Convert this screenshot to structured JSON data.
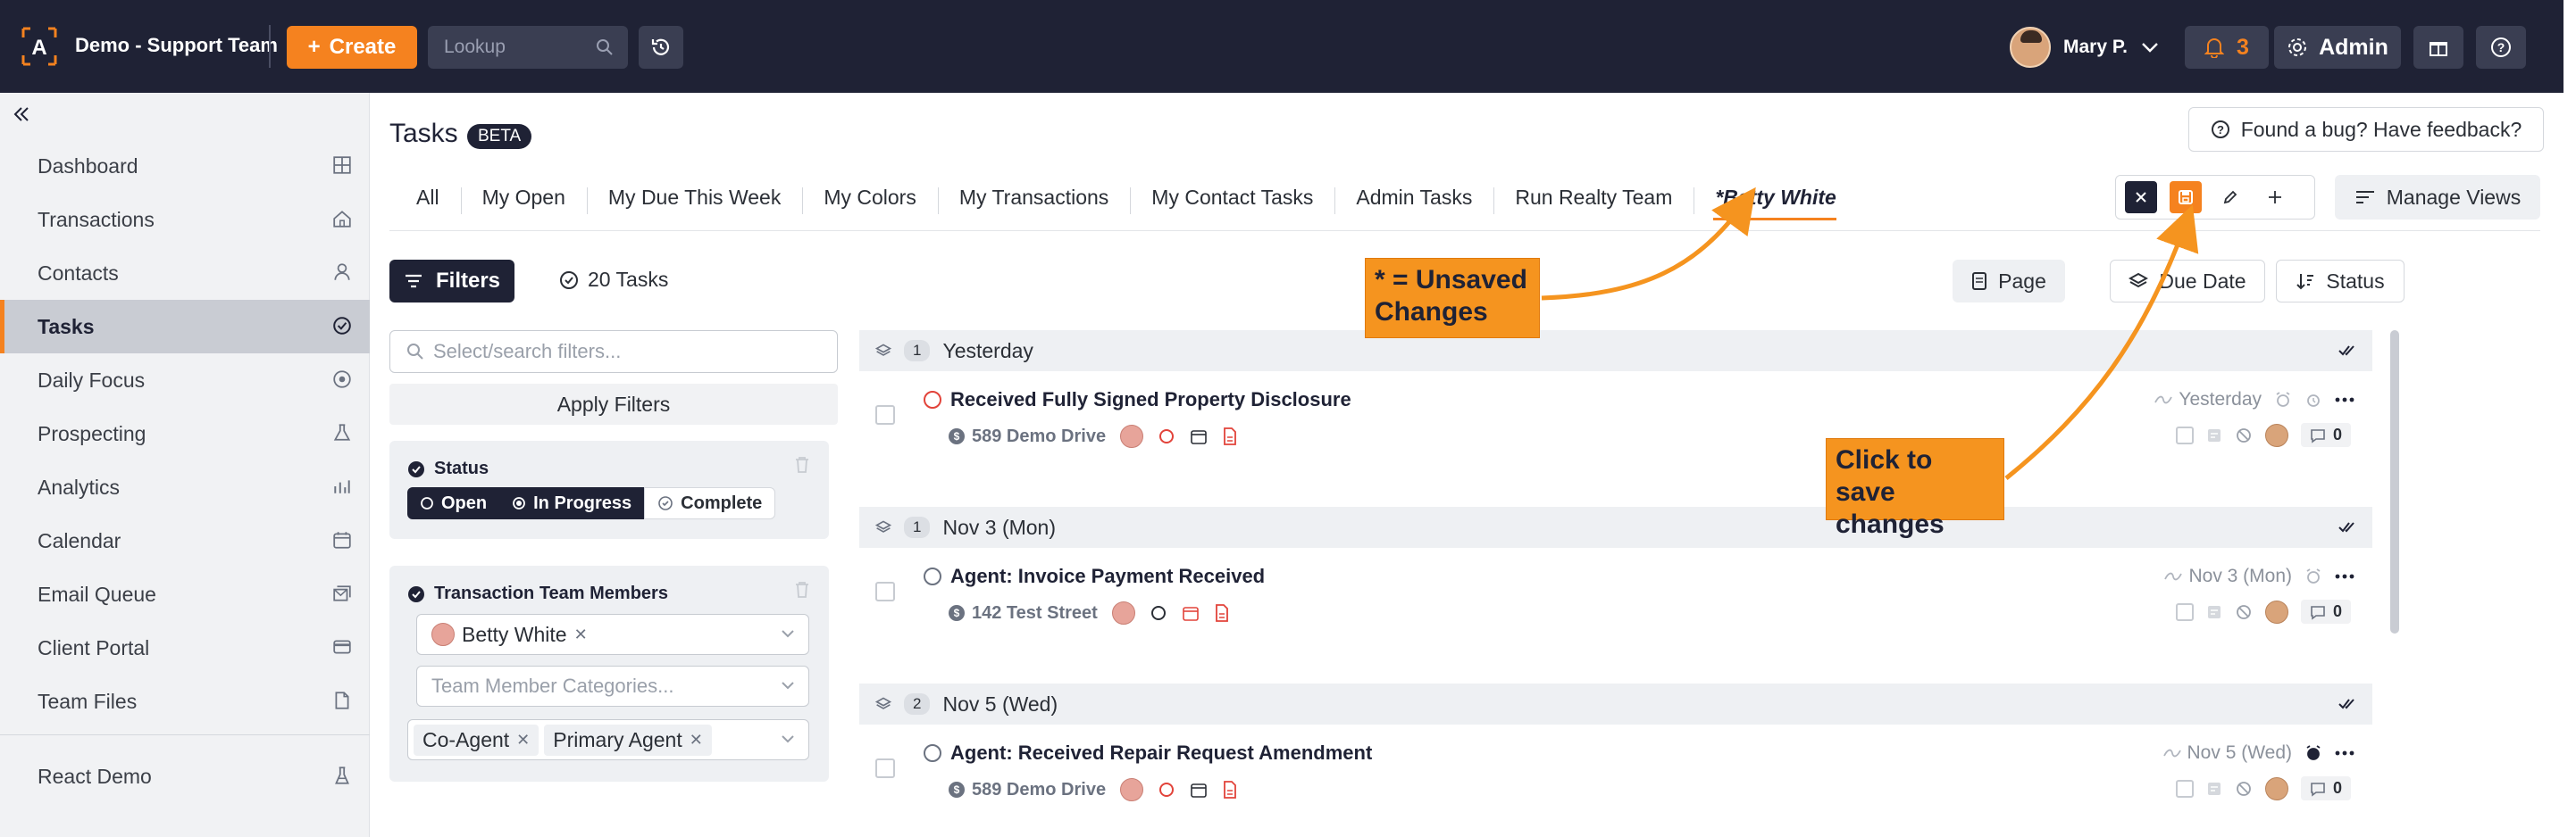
{
  "header": {
    "brand": "Demo - Support Team",
    "create_label": "Create",
    "lookup_placeholder": "Lookup",
    "user_name": "Mary P.",
    "notifications_count": "3",
    "admin_label": "Admin"
  },
  "sidebar": {
    "items": [
      {
        "label": "Dashboard",
        "icon": "grid-icon"
      },
      {
        "label": "Transactions",
        "icon": "home-icon"
      },
      {
        "label": "Contacts",
        "icon": "person-icon"
      },
      {
        "label": "Tasks",
        "icon": "check-circle-icon"
      },
      {
        "label": "Daily Focus",
        "icon": "target-icon"
      },
      {
        "label": "Prospecting",
        "icon": "flask-icon"
      },
      {
        "label": "Analytics",
        "icon": "chart-icon"
      },
      {
        "label": "Calendar",
        "icon": "calendar-icon"
      },
      {
        "label": "Email Queue",
        "icon": "mail-queue-icon"
      },
      {
        "label": "Client Portal",
        "icon": "card-icon"
      },
      {
        "label": "Team Files",
        "icon": "file-icon"
      },
      {
        "label": "React Demo",
        "icon": "beaker-icon"
      }
    ]
  },
  "page": {
    "title": "Tasks",
    "beta": "BETA",
    "feedback": "Found a bug? Have feedback?"
  },
  "tabs": [
    "All",
    "My Open",
    "My Due This Week",
    "My Colors",
    "My Transactions",
    "My Contact Tasks",
    "Admin Tasks",
    "Run Realty Team",
    "*Betty White"
  ],
  "toolbar": {
    "manage_views": "Manage Views",
    "filters": "Filters",
    "task_count": "20 Tasks",
    "page": "Page",
    "due_date": "Due Date",
    "status": "Status"
  },
  "filters": {
    "search_placeholder": "Select/search filters...",
    "apply": "Apply Filters",
    "status_title": "Status",
    "status_options": [
      "Open",
      "In Progress",
      "Complete"
    ],
    "team_title": "Transaction Team Members",
    "member": "Betty White",
    "categories_placeholder": "Team Member Categories...",
    "roles": [
      "Co-Agent",
      "Primary Agent"
    ]
  },
  "groups": [
    {
      "label": "Yesterday",
      "count": "1"
    },
    {
      "label": "Nov 3 (Mon)",
      "count": "1"
    },
    {
      "label": "Nov 5 (Wed)",
      "count": "2"
    }
  ],
  "tasks": [
    {
      "title": "Received Fully Signed Property Disclosure",
      "address": "589 Demo Drive",
      "due": "Yesterday",
      "comments": "0"
    },
    {
      "title": "Agent: Invoice Payment Received",
      "address": "142 Test Street",
      "due": "Nov 3 (Mon)",
      "comments": "0"
    },
    {
      "title": "Agent: Received Repair Request Amendment",
      "address": "589 Demo Drive",
      "due": "Nov 5 (Wed)",
      "comments": "0"
    }
  ],
  "annotations": {
    "unsaved": "* = Unsaved Changes",
    "save": "Click to save changes"
  },
  "colors": {
    "accent": "#f5821f",
    "navy": "#1f2235",
    "callout": "#f5941f"
  }
}
